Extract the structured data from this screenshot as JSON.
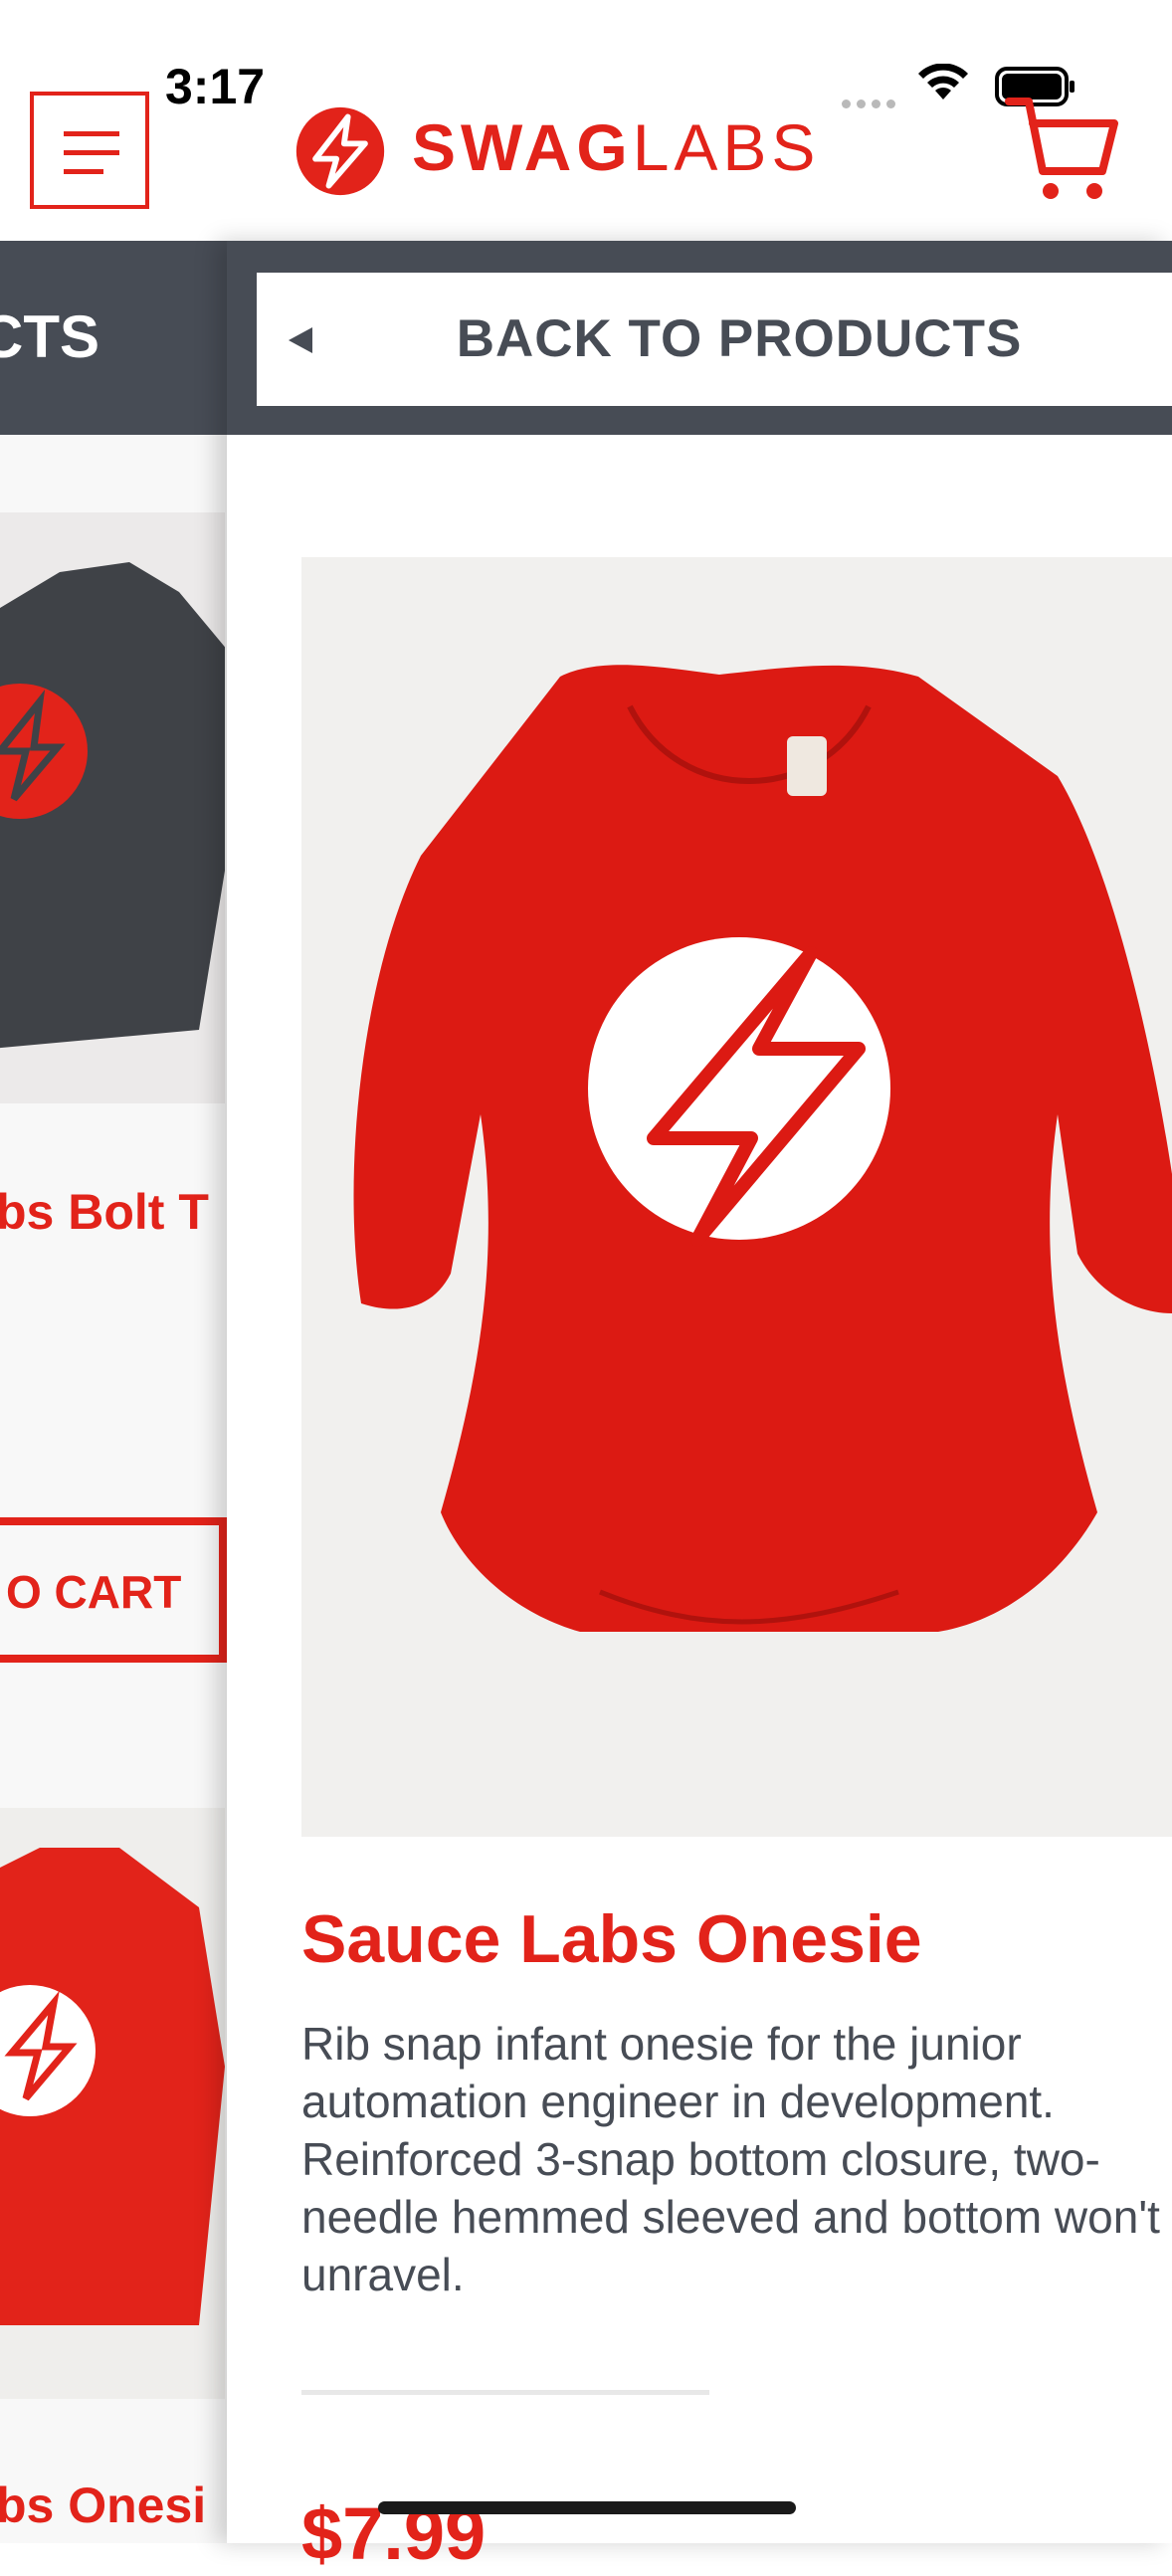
{
  "status": {
    "time": "3:17"
  },
  "header": {
    "logo_bold": "SWAG",
    "logo_light": "LABS"
  },
  "background_list": {
    "title_fragment": "CTS",
    "items": [
      {
        "name_fragment": "bs Bolt T"
      },
      {
        "name_fragment": "bs Onesi"
      }
    ],
    "add_to_cart_fragment": "O CART"
  },
  "detail": {
    "back_label": "BACK TO PRODUCTS",
    "product_name": "Sauce Labs Onesie",
    "description_lines": [
      "Rib snap infant onesie for the junior",
      "automation engineer in development.",
      "Reinforced 3-snap bottom closure, two-",
      "needle hemmed sleeved and bottom won't",
      "unravel."
    ],
    "price": "$7.99"
  },
  "colors": {
    "brand_red": "#e2231a",
    "header_gray": "#474c55",
    "shirt_gray": "#3f4247"
  }
}
